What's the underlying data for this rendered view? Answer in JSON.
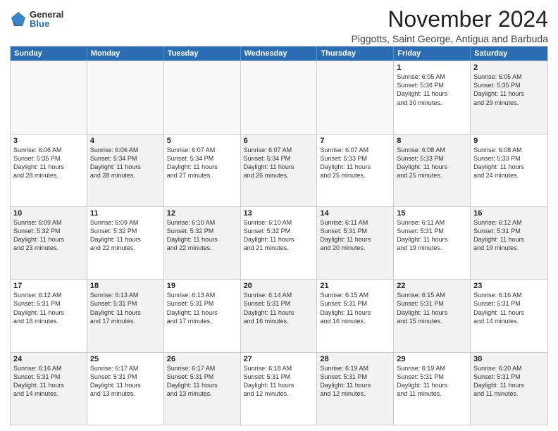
{
  "logo": {
    "general": "General",
    "blue": "Blue"
  },
  "title": "November 2024",
  "location": "Piggotts, Saint George, Antigua and Barbuda",
  "days_header": [
    "Sunday",
    "Monday",
    "Tuesday",
    "Wednesday",
    "Thursday",
    "Friday",
    "Saturday"
  ],
  "weeks": [
    [
      {
        "day": "",
        "detail": "",
        "empty": true
      },
      {
        "day": "",
        "detail": "",
        "empty": true
      },
      {
        "day": "",
        "detail": "",
        "empty": true
      },
      {
        "day": "",
        "detail": "",
        "empty": true
      },
      {
        "day": "",
        "detail": "",
        "empty": true
      },
      {
        "day": "1",
        "detail": "Sunrise: 6:05 AM\nSunset: 5:36 PM\nDaylight: 11 hours\nand 30 minutes."
      },
      {
        "day": "2",
        "detail": "Sunrise: 6:05 AM\nSunset: 5:35 PM\nDaylight: 11 hours\nand 29 minutes.",
        "shaded": true
      }
    ],
    [
      {
        "day": "3",
        "detail": "Sunrise: 6:06 AM\nSunset: 5:35 PM\nDaylight: 11 hours\nand 28 minutes."
      },
      {
        "day": "4",
        "detail": "Sunrise: 6:06 AM\nSunset: 5:34 PM\nDaylight: 11 hours\nand 28 minutes.",
        "shaded": true
      },
      {
        "day": "5",
        "detail": "Sunrise: 6:07 AM\nSunset: 5:34 PM\nDaylight: 11 hours\nand 27 minutes."
      },
      {
        "day": "6",
        "detail": "Sunrise: 6:07 AM\nSunset: 5:34 PM\nDaylight: 11 hours\nand 26 minutes.",
        "shaded": true
      },
      {
        "day": "7",
        "detail": "Sunrise: 6:07 AM\nSunset: 5:33 PM\nDaylight: 11 hours\nand 25 minutes."
      },
      {
        "day": "8",
        "detail": "Sunrise: 6:08 AM\nSunset: 5:33 PM\nDaylight: 11 hours\nand 25 minutes.",
        "shaded": true
      },
      {
        "day": "9",
        "detail": "Sunrise: 6:08 AM\nSunset: 5:33 PM\nDaylight: 11 hours\nand 24 minutes."
      }
    ],
    [
      {
        "day": "10",
        "detail": "Sunrise: 6:09 AM\nSunset: 5:32 PM\nDaylight: 11 hours\nand 23 minutes.",
        "shaded": true
      },
      {
        "day": "11",
        "detail": "Sunrise: 6:09 AM\nSunset: 5:32 PM\nDaylight: 11 hours\nand 22 minutes."
      },
      {
        "day": "12",
        "detail": "Sunrise: 6:10 AM\nSunset: 5:32 PM\nDaylight: 11 hours\nand 22 minutes.",
        "shaded": true
      },
      {
        "day": "13",
        "detail": "Sunrise: 6:10 AM\nSunset: 5:32 PM\nDaylight: 11 hours\nand 21 minutes."
      },
      {
        "day": "14",
        "detail": "Sunrise: 6:11 AM\nSunset: 5:31 PM\nDaylight: 11 hours\nand 20 minutes.",
        "shaded": true
      },
      {
        "day": "15",
        "detail": "Sunrise: 6:11 AM\nSunset: 5:31 PM\nDaylight: 11 hours\nand 19 minutes."
      },
      {
        "day": "16",
        "detail": "Sunrise: 6:12 AM\nSunset: 5:31 PM\nDaylight: 11 hours\nand 19 minutes.",
        "shaded": true
      }
    ],
    [
      {
        "day": "17",
        "detail": "Sunrise: 6:12 AM\nSunset: 5:31 PM\nDaylight: 11 hours\nand 18 minutes."
      },
      {
        "day": "18",
        "detail": "Sunrise: 6:13 AM\nSunset: 5:31 PM\nDaylight: 11 hours\nand 17 minutes.",
        "shaded": true
      },
      {
        "day": "19",
        "detail": "Sunrise: 6:13 AM\nSunset: 5:31 PM\nDaylight: 11 hours\nand 17 minutes."
      },
      {
        "day": "20",
        "detail": "Sunrise: 6:14 AM\nSunset: 5:31 PM\nDaylight: 11 hours\nand 16 minutes.",
        "shaded": true
      },
      {
        "day": "21",
        "detail": "Sunrise: 6:15 AM\nSunset: 5:31 PM\nDaylight: 11 hours\nand 16 minutes."
      },
      {
        "day": "22",
        "detail": "Sunrise: 6:15 AM\nSunset: 5:31 PM\nDaylight: 11 hours\nand 15 minutes.",
        "shaded": true
      },
      {
        "day": "23",
        "detail": "Sunrise: 6:16 AM\nSunset: 5:31 PM\nDaylight: 11 hours\nand 14 minutes."
      }
    ],
    [
      {
        "day": "24",
        "detail": "Sunrise: 6:16 AM\nSunset: 5:31 PM\nDaylight: 11 hours\nand 14 minutes.",
        "shaded": true
      },
      {
        "day": "25",
        "detail": "Sunrise: 6:17 AM\nSunset: 5:31 PM\nDaylight: 11 hours\nand 13 minutes."
      },
      {
        "day": "26",
        "detail": "Sunrise: 6:17 AM\nSunset: 5:31 PM\nDaylight: 11 hours\nand 13 minutes.",
        "shaded": true
      },
      {
        "day": "27",
        "detail": "Sunrise: 6:18 AM\nSunset: 5:31 PM\nDaylight: 11 hours\nand 12 minutes."
      },
      {
        "day": "28",
        "detail": "Sunrise: 6:19 AM\nSunset: 5:31 PM\nDaylight: 11 hours\nand 12 minutes.",
        "shaded": true
      },
      {
        "day": "29",
        "detail": "Sunrise: 6:19 AM\nSunset: 5:31 PM\nDaylight: 11 hours\nand 11 minutes."
      },
      {
        "day": "30",
        "detail": "Sunrise: 6:20 AM\nSunset: 5:31 PM\nDaylight: 11 hours\nand 11 minutes.",
        "shaded": true
      }
    ]
  ]
}
